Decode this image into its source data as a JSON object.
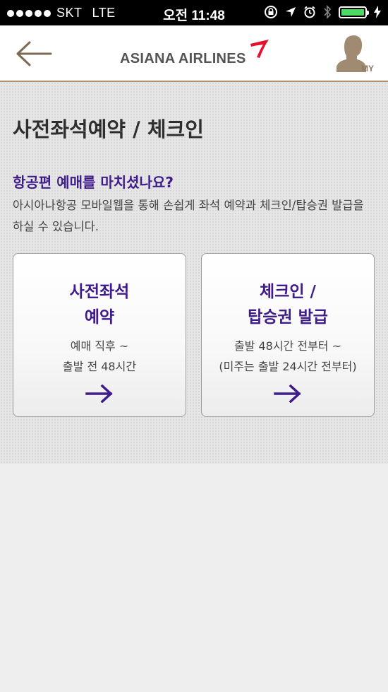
{
  "status_bar": {
    "carrier": "SKT",
    "network": "LTE",
    "time": "오전 11:48",
    "battery_color": "#4cd964"
  },
  "nav": {
    "back_icon": "back-arrow-icon",
    "logo_text": "ASIANA AIRLINES",
    "logo_mark_color": "#e8112d",
    "my_label": "MY"
  },
  "main": {
    "title": "사전좌석예약 / 체크인",
    "question": "항공편 예매를 마치셨나요?",
    "description": "아시아나항공 모바일웹을 통해 손쉽게 좌석 예약과 체크인/탑승권 발급을 하실 수 있습니다.",
    "accent_color": "#3f1c8b",
    "cards": [
      {
        "title_line1": "사전좌석",
        "title_line2": "예약",
        "sub_line1": "예매 직후 ~",
        "sub_line2": "출발 전 48시간",
        "icon": "right-arrow-icon"
      },
      {
        "title_line1": "체크인 /",
        "title_line2": "탑승권 발급",
        "sub_line1": "출발 48시간 전부터 ~",
        "sub_line2": "(미주는 출발 24시간 전부터)",
        "icon": "right-arrow-icon"
      }
    ]
  }
}
